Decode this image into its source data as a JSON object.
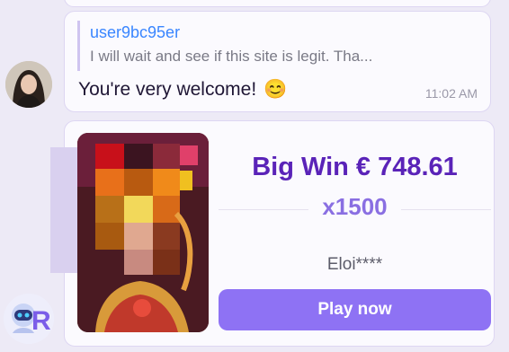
{
  "quoted_message": {
    "user": "user9bc95er",
    "text": "I will wait and see if this site is legit. Tha..."
  },
  "reply": {
    "text": "You're very welcome!",
    "emoji": "😊",
    "time": "11:02 AM"
  },
  "win": {
    "title": "Big Win € 748.61",
    "multiplier": "x1500",
    "player": "Eloi****",
    "button_label": "Play now"
  },
  "bot_avatar": {
    "label": "R"
  },
  "colors": {
    "accent": "#8e72f4",
    "win_title": "#5a23b8",
    "username": "#3a86ff"
  }
}
